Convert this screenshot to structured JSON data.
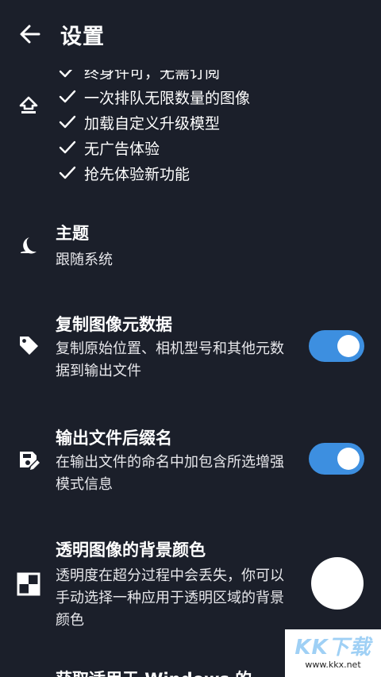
{
  "header": {
    "title": "设置",
    "back_icon": "arrow-left-icon"
  },
  "upgrade": {
    "icon": "upload-icon",
    "features": [
      "终身许可，无需订阅",
      "一次排队无限数量的图像",
      "加载自定义升级模型",
      "无广告体验",
      "抢先体验新功能"
    ]
  },
  "settings": {
    "theme": {
      "title": "主题",
      "value": "跟随系统",
      "icon": "moon-icon"
    },
    "copy_metadata": {
      "title": "复制图像元数据",
      "desc": "复制原始位置、相机型号和其他元数据到输出文件",
      "enabled": true,
      "icon": "tag-icon"
    },
    "suffix": {
      "title": "输出文件后缀名",
      "desc": "在输出文件的命名中加包含所选增强模式信息",
      "enabled": true,
      "icon": "save-edit-icon"
    },
    "transparent_bg": {
      "title": "透明图像的背景颜色",
      "desc": "透明度在超分过程中会丢失，你可以手动选择一种应用于透明区域的背景颜色",
      "color": "#ffffff",
      "icon": "transparency-icon"
    },
    "next_item_partial": {
      "title": "获取适用于 Windows 的"
    }
  },
  "watermark": {
    "main": "KK下载",
    "sub": "www.kkx.net"
  },
  "colors": {
    "background": "#1b1f2a",
    "accent": "#3d8fe0",
    "text": "#ffffff"
  }
}
